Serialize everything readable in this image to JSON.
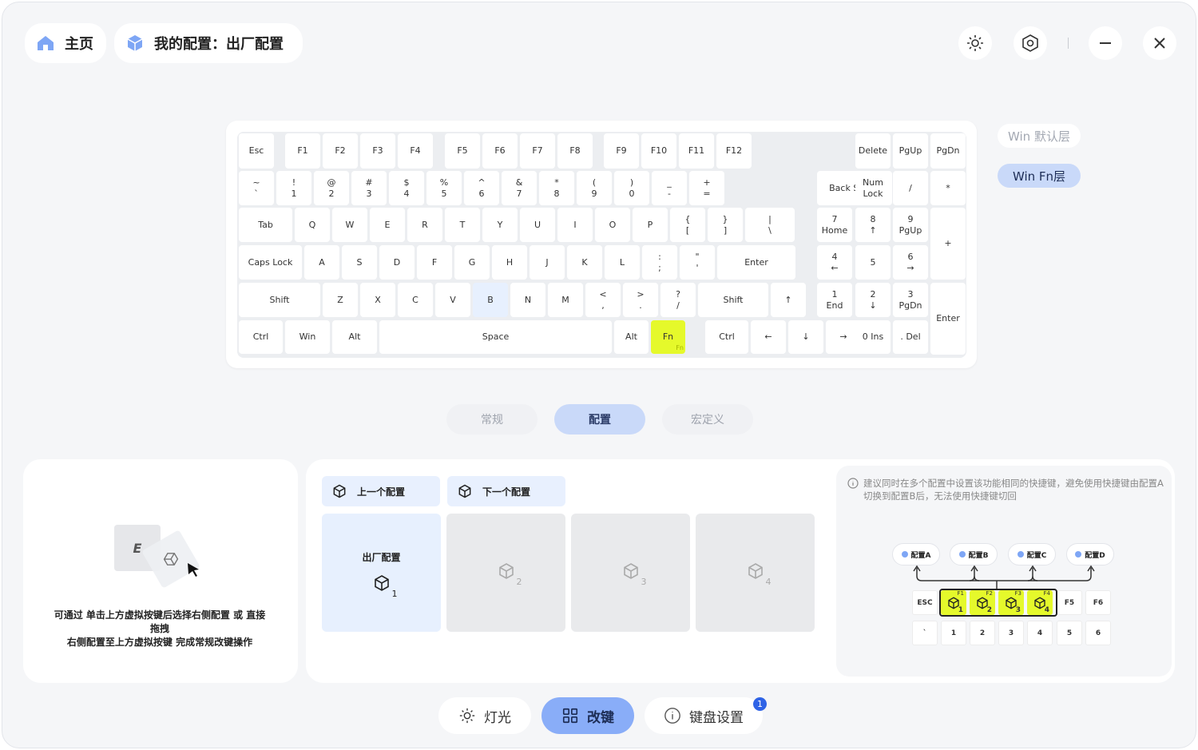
{
  "header": {
    "home_label": "主页",
    "config_label": "我的配置：出厂配置",
    "icons": [
      "brightness-icon",
      "settings-icon",
      "minimize-icon",
      "close-icon"
    ]
  },
  "keyboard": {
    "selected_key": "B",
    "highlighted_key": "Fn",
    "rows": [
      [
        "Esc",
        "F1",
        "F2",
        "F3",
        "F4",
        "F5",
        "F6",
        "F7",
        "F8",
        "F9",
        "F10",
        "F11",
        "F12",
        "Delete",
        "PgUp",
        "PgDn"
      ],
      [
        "~\n`",
        "!\n1",
        "@\n2",
        "#\n3",
        "$\n4",
        "%\n5",
        "^\n6",
        "&\n7",
        "*\n8",
        "(\n9",
        ")\n0",
        "_\n-",
        "+\n=",
        "Back Space",
        "Num\nLock",
        "/",
        "*",
        "-"
      ],
      [
        "Tab",
        "Q",
        "W",
        "E",
        "R",
        "T",
        "Y",
        "U",
        "I",
        "O",
        "P",
        "{\n[",
        "}\n]",
        "|\n\\",
        "7\nHome",
        "8\n↑",
        "9\nPgUp",
        "+"
      ],
      [
        "Caps Lock",
        "A",
        "S",
        "D",
        "F",
        "G",
        "H",
        "J",
        "K",
        "L",
        ":\n;",
        "\"\n'",
        "Enter",
        "4\n←",
        "5",
        "6\n→"
      ],
      [
        "Shift",
        "Z",
        "X",
        "C",
        "V",
        "B",
        "N",
        "M",
        "<\n,",
        ">\n.",
        "?\n/",
        "Shift",
        "↑",
        "1\nEnd",
        "2\n↓",
        "3\nPgDn",
        "Enter"
      ],
      [
        "Ctrl",
        "Win",
        "Alt",
        "Space",
        "Alt",
        "Fn",
        "Ctrl",
        "←",
        "↓",
        "→",
        "0 Ins",
        ". Del"
      ]
    ],
    "fn_sub": "Fn"
  },
  "layers": {
    "default": "Win 默认层",
    "fn": "Win Fn层",
    "active": "fn"
  },
  "mode_tabs": {
    "items": [
      "常规",
      "配置",
      "宏定义"
    ],
    "active": 1
  },
  "hint": {
    "key_label": "E",
    "text_1": "可通过 单击上方虚拟按键后选择右侧配置 或 直接拖拽",
    "text_2": "右侧配置至上方虚拟按键 完成常规改键操作"
  },
  "config_nav": {
    "prev": "上一个配置",
    "next": "下一个配置"
  },
  "config_slots": [
    {
      "name": "出厂配置",
      "num": "1",
      "active": true
    },
    {
      "name": "",
      "num": "2",
      "active": false
    },
    {
      "name": "",
      "num": "3",
      "active": false
    },
    {
      "name": "",
      "num": "4",
      "active": false
    }
  ],
  "tip": {
    "text": "建议同时在多个配置中设置该功能相同的快捷键，避免使用快捷键由配置A切换到配置B后，无法使用快捷键切回",
    "chips": [
      "配置A",
      "配置B",
      "配置C",
      "配置D"
    ],
    "mini_row1": [
      "ESC",
      "",
      "",
      "",
      "",
      "F5",
      "F6"
    ],
    "mini_fkeys": [
      "F1",
      "F2",
      "F3",
      "F4"
    ],
    "mini_nums": [
      "1",
      "2",
      "3",
      "4"
    ],
    "mini_row2": [
      "`",
      "1",
      "2",
      "3",
      "4",
      "5",
      "6"
    ]
  },
  "bottom_tabs": {
    "items": [
      "灯光",
      "改键",
      "键盘设置"
    ],
    "active": 1,
    "badge": "1"
  },
  "colors": {
    "accent": "#89adf8",
    "highlight": "#e5f92b",
    "selected": "#e7f0fe"
  }
}
